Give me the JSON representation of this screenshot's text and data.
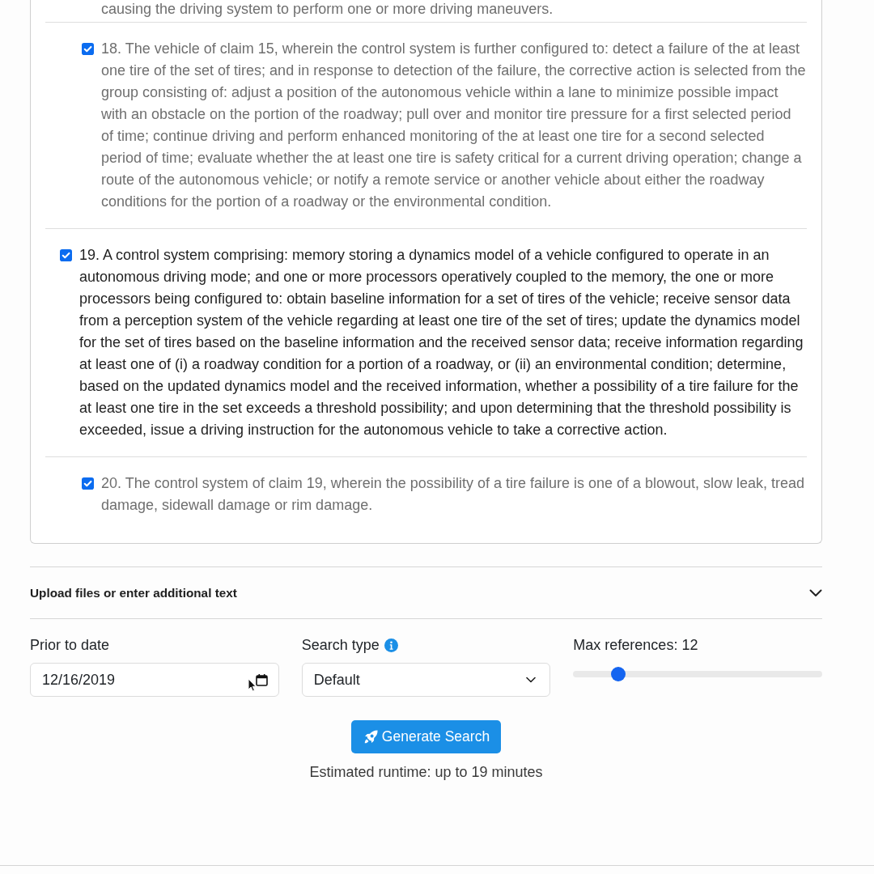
{
  "claims_panel": {
    "cut_off_text": "causing the driving system to perform one or more driving maneuvers.",
    "claims": [
      {
        "kind": "dependent",
        "checked": true,
        "text": "18. The vehicle of claim 15, wherein the control system is further configured to: detect a failure of the at least one tire of the set of tires; and in response to detection of the failure, the corrective action is selected from the group consisting of: adjust a position of the autonomous vehicle within a lane to minimize possible impact with an obstacle on the portion of the roadway; pull over and monitor tire pressure for a first selected period of time; continue driving and perform enhanced monitoring of the at least one tire for a second selected period of time; evaluate whether the at least one tire is safety critical for a current driving operation; change a route of the autonomous vehicle; or notify a remote service or another vehicle about either the roadway conditions for the portion of a roadway or the environmental condition."
      },
      {
        "kind": "independent",
        "checked": true,
        "text": "19. A control system comprising: memory storing a dynamics model of a vehicle configured to operate in an autonomous driving mode; and one or more processors operatively coupled to the memory, the one or more processors being configured to: obtain baseline information for a set of tires of the vehicle; receive sensor data from a perception system of the vehicle regarding at least one tire of the set of tires; update the dynamics model for the set of tires based on the baseline information and the received sensor data; receive information regarding at least one of (i) a roadway condition for a portion of a roadway, or (ii) an environmental condition; determine, based on the updated dynamics model and the received information, whether a possibility of a tire failure for the at least one tire in the set exceeds a threshold possibility; and upon determining that the threshold possibility is exceeded, issue a driving instruction for the autonomous vehicle to take a corrective action."
      },
      {
        "kind": "dependent",
        "checked": true,
        "text": "20. The control system of claim 19, wherein the possibility of a tire failure is one of a blowout, slow leak, tread damage, sidewall damage or rim damage."
      }
    ]
  },
  "upload_section": {
    "title": "Upload files or enter additional text",
    "expanded": false
  },
  "form": {
    "prior_to_date": {
      "label": "Prior to date",
      "value": "12/16/2019"
    },
    "search_type": {
      "label": "Search type",
      "value": "Default"
    },
    "max_references": {
      "label": "Max references: 12",
      "level": 0.16
    }
  },
  "generate_button": {
    "label": "Generate Search"
  },
  "runtime_note": "Estimated runtime: up to 19 minutes"
}
